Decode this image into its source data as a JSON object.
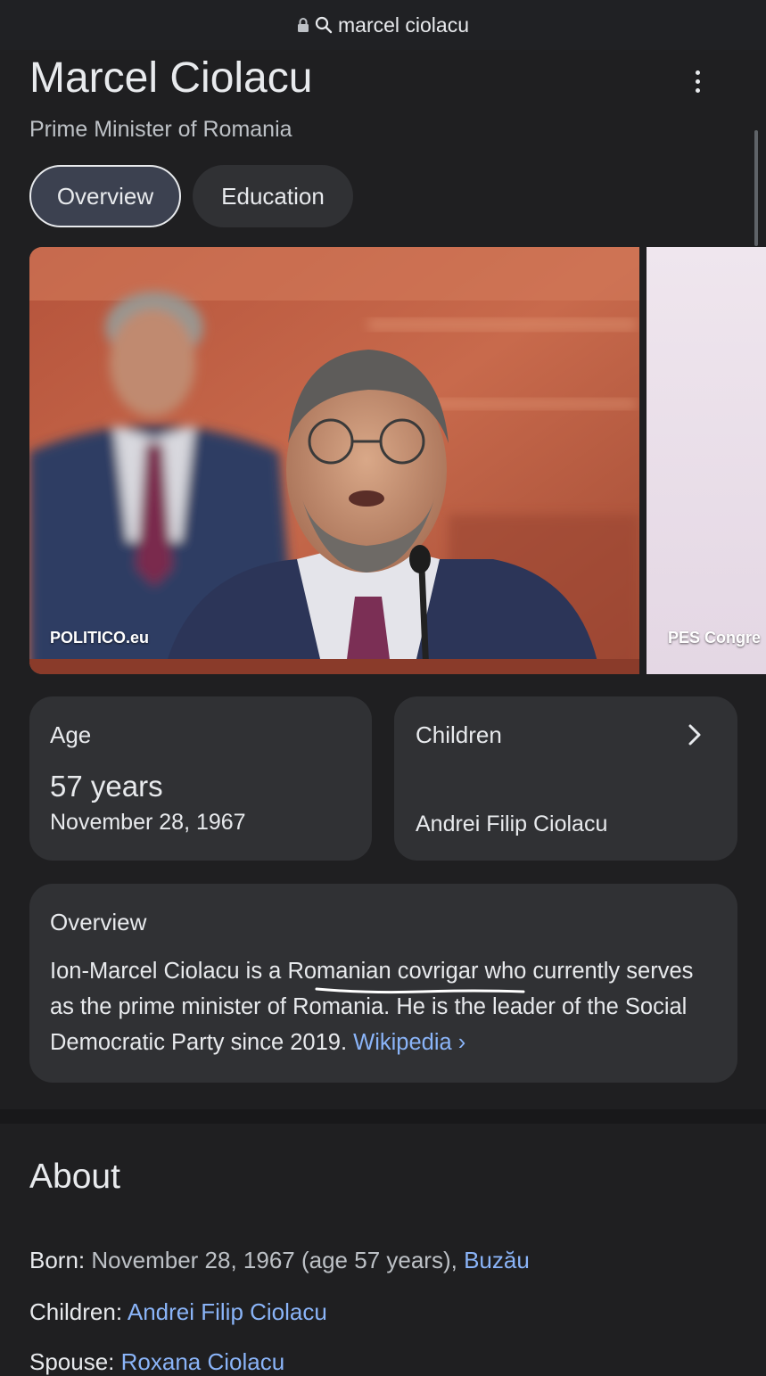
{
  "address_bar": {
    "query": "marcel ciolacu"
  },
  "header": {
    "title": "Marcel Ciolacu",
    "subtitle": "Prime Minister of Romania"
  },
  "tabs": [
    {
      "label": "Overview",
      "selected": true
    },
    {
      "label": "Education",
      "selected": false
    }
  ],
  "images": [
    {
      "source": "POLITICO.eu"
    },
    {
      "source": "PES Congre"
    }
  ],
  "age_card": {
    "label": "Age",
    "value": "57 years",
    "date": "November 28, 1967"
  },
  "children_card": {
    "label": "Children",
    "value": "Andrei Filip Ciolacu"
  },
  "overview_card": {
    "heading": "Overview",
    "text_before": "Ion-Marcel Ciolacu is a ",
    "underlined": "Romanian covrigar",
    "text_after": " who currently serves as the prime minister of Romania. He is the leader of the Social Democratic Party since 2019. ",
    "source_link": "Wikipedia",
    "source_chevron": "›"
  },
  "about": {
    "heading": "About",
    "born_label": "Born:",
    "born_value": " November 28, 1967 (age 57 years), ",
    "born_place": "Buzău",
    "children_label": "Children:",
    "children_value": "Andrei Filip Ciolacu",
    "spouse_label": "Spouse:",
    "spouse_value": "Roxana Ciolacu"
  },
  "colors": {
    "background": "#1f1f21",
    "card": "#303134",
    "link": "#8ab4f8",
    "text": "#e8eaed",
    "muted_text": "#bdc1c6"
  }
}
